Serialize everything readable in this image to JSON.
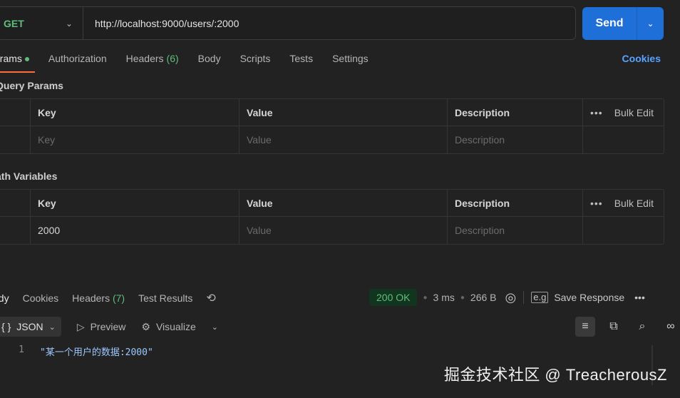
{
  "request": {
    "method": "GET",
    "url": "http://localhost:9000/users/:2000",
    "send_label": "Send"
  },
  "req_tabs": [
    {
      "label": "arams",
      "active": true
    },
    {
      "label": "Authorization"
    },
    {
      "label": "Headers",
      "count": "(6)"
    },
    {
      "label": "Body"
    },
    {
      "label": "Scripts"
    },
    {
      "label": "Tests"
    },
    {
      "label": "Settings"
    }
  ],
  "cookies_label": "Cookies",
  "query_params": {
    "title": "Query Params",
    "headers": [
      "Key",
      "Value",
      "Description"
    ],
    "bulk_edit": "Bulk Edit",
    "row": {
      "key_placeholder": "Key",
      "value_placeholder": "Value",
      "desc_placeholder": "Description"
    }
  },
  "path_variables": {
    "title": "ath Variables",
    "headers": [
      "Key",
      "Value",
      "Description"
    ],
    "bulk_edit": "Bulk Edit",
    "row": {
      "key": "2000",
      "value_placeholder": "Value",
      "desc_placeholder": "Description"
    }
  },
  "response": {
    "tabs": [
      {
        "label": "ody",
        "active": true
      },
      {
        "label": "Cookies"
      },
      {
        "label": "Headers",
        "count": "(7)"
      },
      {
        "label": "Test Results"
      }
    ],
    "status": "200 OK",
    "time": "3 ms",
    "size": "266 B",
    "save_label": "Save Response"
  },
  "format": {
    "selected": "JSON",
    "preview": "Preview",
    "visualize": "Visualize"
  },
  "body_lines": [
    {
      "num": "1",
      "text": "\"某一个用户的数据:2000\""
    }
  ],
  "watermark": "掘金技术社区 @ TreacherousZ",
  "colors": {
    "accent_orange": "#ff6c37",
    "send_blue": "#1f6fd9",
    "green": "#5fbf7a",
    "link_blue": "#5aa2ff"
  }
}
